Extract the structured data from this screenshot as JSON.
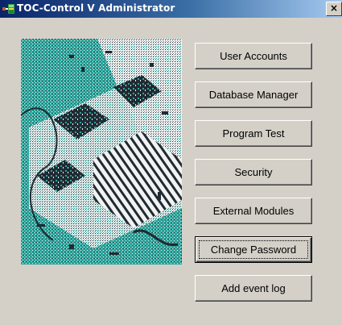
{
  "window": {
    "title": "TOC-Control V Administrator",
    "close_glyph": "×",
    "app_icon": "network-app-icon",
    "close_icon": "close-icon"
  },
  "picture": {
    "subject": "decorative-circuit-board-illustration",
    "colors": {
      "teal": "#2aa39a",
      "dark": "#1f2a33",
      "light": "#f2f2f2"
    }
  },
  "buttons": [
    {
      "label": "User Accounts"
    },
    {
      "label": "Database Manager"
    },
    {
      "label": "Program Test"
    },
    {
      "label": "Security"
    },
    {
      "label": "External Modules"
    },
    {
      "label": "Change Password",
      "default": true
    },
    {
      "label": "Add event log"
    }
  ]
}
